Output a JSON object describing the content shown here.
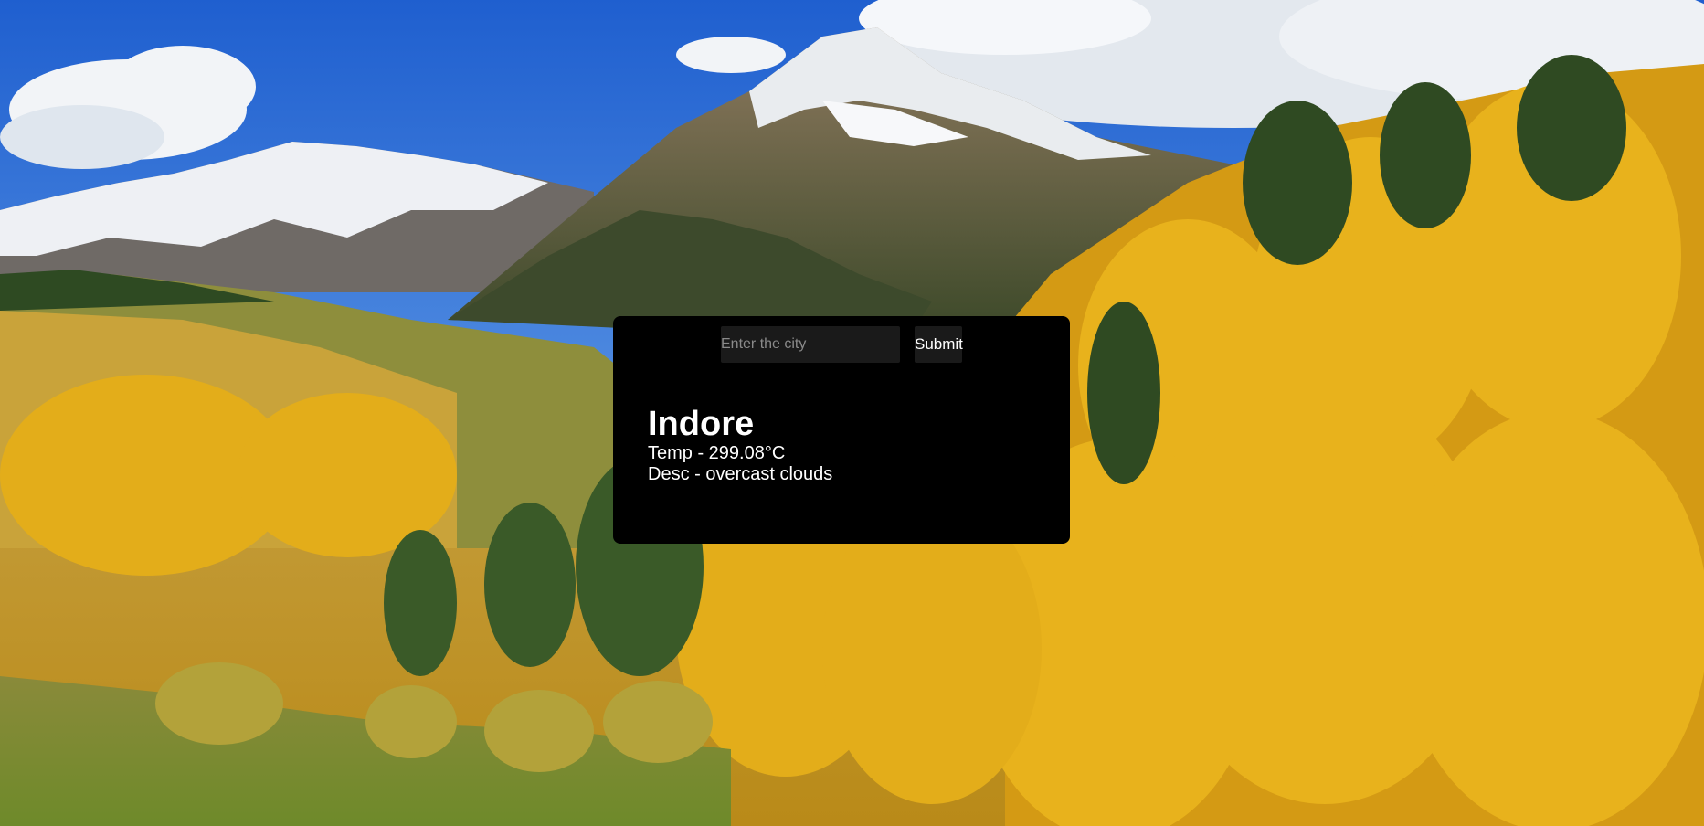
{
  "search": {
    "placeholder": "Enter the city",
    "value": "",
    "submit_label": "Submit"
  },
  "weather": {
    "city": "Indore",
    "temp_text": "Temp - 299.08°C",
    "desc_text": "Desc - overcast clouds"
  },
  "background": {
    "sky": "#2f6fd6",
    "foliage": "#e0a81a"
  }
}
